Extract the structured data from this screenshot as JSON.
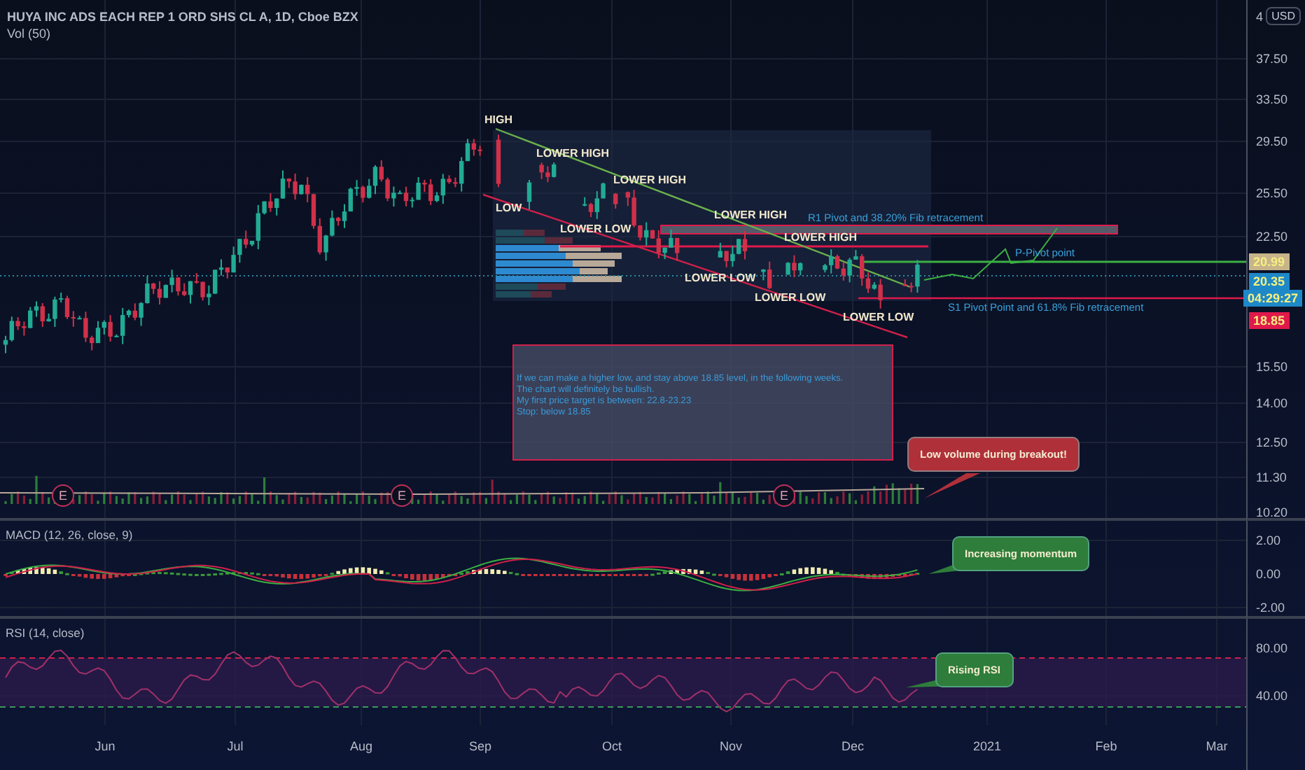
{
  "legend": {
    "title": "HUYA INC ADS EACH REP 1 ORD SHS CL A, 1D, Cboe BZX",
    "volume": "Vol (50)"
  },
  "price_axis": {
    "currency": "USD",
    "ticks": [
      "4",
      "37.50",
      "33.50",
      "29.50",
      "25.50",
      "22.50",
      "15.50",
      "14.00",
      "12.50",
      "11.30",
      "10.20"
    ],
    "price_labels": [
      {
        "text": "20.99",
        "color": "#c8b48a"
      },
      {
        "text": "20.35",
        "color": "#1e88c8"
      },
      {
        "text": "04:29:27",
        "color": "#1e88c8"
      },
      {
        "text": "18.85",
        "color": "#e0194b"
      }
    ]
  },
  "swing_labels": [
    "HIGH",
    "LOWER HIGH",
    "LOWER HIGH",
    "LOW",
    "LOWER LOW",
    "LOWER HIGH",
    "LOWER HIGH",
    "LOWER LOW",
    "LOWER LOW",
    "LOWER LOW"
  ],
  "level_labels": [
    "R1 Pivot and 38.20% Fib retracement",
    "P-Pivot point",
    "S1 Pivot Point and 61.8% Fib retracement"
  ],
  "note": {
    "lines": [
      "If we can make a higher low, and stay above 18.85 level, in the following weeks.",
      "The chart will definitely be bullish.",
      "My first price target is between: 22.8-23.23",
      "Stop: below 18.85"
    ]
  },
  "earnings_markers": [
    "E",
    "E",
    "E"
  ],
  "callouts": [
    {
      "text": "Low volume during breakout!",
      "color": "#b0303a"
    },
    {
      "text": "Increasing momentum",
      "color": "#2e7d3a"
    },
    {
      "text": "Rising RSI",
      "color": "#2e7d3a"
    }
  ],
  "macd": {
    "title": "MACD (12, 26, close, 9)",
    "ticks": [
      "2.00",
      "0.00",
      "-2.00"
    ]
  },
  "rsi": {
    "title": "RSI (14, close)",
    "ticks": [
      "80.00",
      "40.00"
    ]
  },
  "time_axis": [
    "Jun",
    "Jul",
    "Aug",
    "Sep",
    "Oct",
    "Nov",
    "Dec",
    "2021",
    "Feb",
    "Mar"
  ]
}
